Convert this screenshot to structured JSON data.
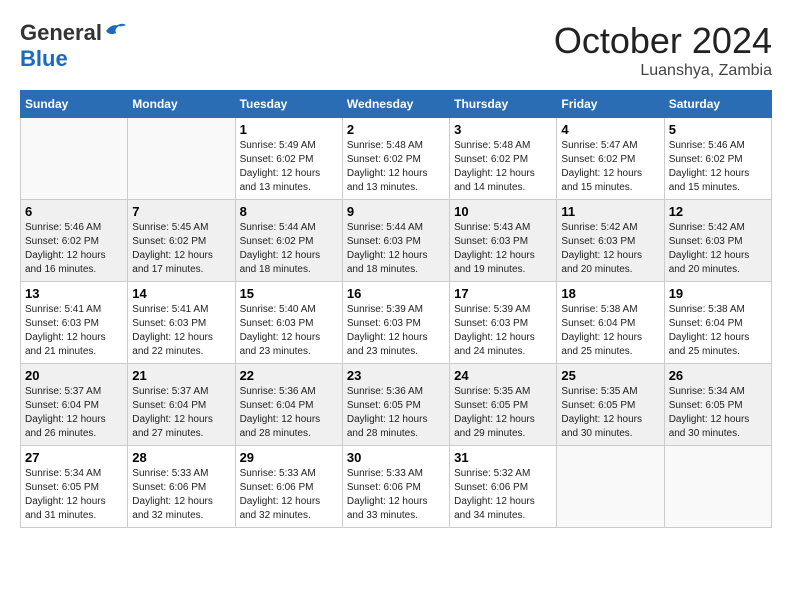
{
  "logo": {
    "general": "General",
    "blue": "Blue"
  },
  "title": {
    "month": "October 2024",
    "location": "Luanshya, Zambia"
  },
  "weekdays": [
    "Sunday",
    "Monday",
    "Tuesday",
    "Wednesday",
    "Thursday",
    "Friday",
    "Saturday"
  ],
  "weeks": [
    [
      {
        "day": "",
        "sunrise": "",
        "sunset": "",
        "daylight": "",
        "empty": true
      },
      {
        "day": "",
        "sunrise": "",
        "sunset": "",
        "daylight": "",
        "empty": true
      },
      {
        "day": "1",
        "sunrise": "Sunrise: 5:49 AM",
        "sunset": "Sunset: 6:02 PM",
        "daylight": "Daylight: 12 hours and 13 minutes."
      },
      {
        "day": "2",
        "sunrise": "Sunrise: 5:48 AM",
        "sunset": "Sunset: 6:02 PM",
        "daylight": "Daylight: 12 hours and 13 minutes."
      },
      {
        "day": "3",
        "sunrise": "Sunrise: 5:48 AM",
        "sunset": "Sunset: 6:02 PM",
        "daylight": "Daylight: 12 hours and 14 minutes."
      },
      {
        "day": "4",
        "sunrise": "Sunrise: 5:47 AM",
        "sunset": "Sunset: 6:02 PM",
        "daylight": "Daylight: 12 hours and 15 minutes."
      },
      {
        "day": "5",
        "sunrise": "Sunrise: 5:46 AM",
        "sunset": "Sunset: 6:02 PM",
        "daylight": "Daylight: 12 hours and 15 minutes."
      }
    ],
    [
      {
        "day": "6",
        "sunrise": "Sunrise: 5:46 AM",
        "sunset": "Sunset: 6:02 PM",
        "daylight": "Daylight: 12 hours and 16 minutes."
      },
      {
        "day": "7",
        "sunrise": "Sunrise: 5:45 AM",
        "sunset": "Sunset: 6:02 PM",
        "daylight": "Daylight: 12 hours and 17 minutes."
      },
      {
        "day": "8",
        "sunrise": "Sunrise: 5:44 AM",
        "sunset": "Sunset: 6:02 PM",
        "daylight": "Daylight: 12 hours and 18 minutes."
      },
      {
        "day": "9",
        "sunrise": "Sunrise: 5:44 AM",
        "sunset": "Sunset: 6:03 PM",
        "daylight": "Daylight: 12 hours and 18 minutes."
      },
      {
        "day": "10",
        "sunrise": "Sunrise: 5:43 AM",
        "sunset": "Sunset: 6:03 PM",
        "daylight": "Daylight: 12 hours and 19 minutes."
      },
      {
        "day": "11",
        "sunrise": "Sunrise: 5:42 AM",
        "sunset": "Sunset: 6:03 PM",
        "daylight": "Daylight: 12 hours and 20 minutes."
      },
      {
        "day": "12",
        "sunrise": "Sunrise: 5:42 AM",
        "sunset": "Sunset: 6:03 PM",
        "daylight": "Daylight: 12 hours and 20 minutes."
      }
    ],
    [
      {
        "day": "13",
        "sunrise": "Sunrise: 5:41 AM",
        "sunset": "Sunset: 6:03 PM",
        "daylight": "Daylight: 12 hours and 21 minutes."
      },
      {
        "day": "14",
        "sunrise": "Sunrise: 5:41 AM",
        "sunset": "Sunset: 6:03 PM",
        "daylight": "Daylight: 12 hours and 22 minutes."
      },
      {
        "day": "15",
        "sunrise": "Sunrise: 5:40 AM",
        "sunset": "Sunset: 6:03 PM",
        "daylight": "Daylight: 12 hours and 23 minutes."
      },
      {
        "day": "16",
        "sunrise": "Sunrise: 5:39 AM",
        "sunset": "Sunset: 6:03 PM",
        "daylight": "Daylight: 12 hours and 23 minutes."
      },
      {
        "day": "17",
        "sunrise": "Sunrise: 5:39 AM",
        "sunset": "Sunset: 6:03 PM",
        "daylight": "Daylight: 12 hours and 24 minutes."
      },
      {
        "day": "18",
        "sunrise": "Sunrise: 5:38 AM",
        "sunset": "Sunset: 6:04 PM",
        "daylight": "Daylight: 12 hours and 25 minutes."
      },
      {
        "day": "19",
        "sunrise": "Sunrise: 5:38 AM",
        "sunset": "Sunset: 6:04 PM",
        "daylight": "Daylight: 12 hours and 25 minutes."
      }
    ],
    [
      {
        "day": "20",
        "sunrise": "Sunrise: 5:37 AM",
        "sunset": "Sunset: 6:04 PM",
        "daylight": "Daylight: 12 hours and 26 minutes."
      },
      {
        "day": "21",
        "sunrise": "Sunrise: 5:37 AM",
        "sunset": "Sunset: 6:04 PM",
        "daylight": "Daylight: 12 hours and 27 minutes."
      },
      {
        "day": "22",
        "sunrise": "Sunrise: 5:36 AM",
        "sunset": "Sunset: 6:04 PM",
        "daylight": "Daylight: 12 hours and 28 minutes."
      },
      {
        "day": "23",
        "sunrise": "Sunrise: 5:36 AM",
        "sunset": "Sunset: 6:05 PM",
        "daylight": "Daylight: 12 hours and 28 minutes."
      },
      {
        "day": "24",
        "sunrise": "Sunrise: 5:35 AM",
        "sunset": "Sunset: 6:05 PM",
        "daylight": "Daylight: 12 hours and 29 minutes."
      },
      {
        "day": "25",
        "sunrise": "Sunrise: 5:35 AM",
        "sunset": "Sunset: 6:05 PM",
        "daylight": "Daylight: 12 hours and 30 minutes."
      },
      {
        "day": "26",
        "sunrise": "Sunrise: 5:34 AM",
        "sunset": "Sunset: 6:05 PM",
        "daylight": "Daylight: 12 hours and 30 minutes."
      }
    ],
    [
      {
        "day": "27",
        "sunrise": "Sunrise: 5:34 AM",
        "sunset": "Sunset: 6:05 PM",
        "daylight": "Daylight: 12 hours and 31 minutes."
      },
      {
        "day": "28",
        "sunrise": "Sunrise: 5:33 AM",
        "sunset": "Sunset: 6:06 PM",
        "daylight": "Daylight: 12 hours and 32 minutes."
      },
      {
        "day": "29",
        "sunrise": "Sunrise: 5:33 AM",
        "sunset": "Sunset: 6:06 PM",
        "daylight": "Daylight: 12 hours and 32 minutes."
      },
      {
        "day": "30",
        "sunrise": "Sunrise: 5:33 AM",
        "sunset": "Sunset: 6:06 PM",
        "daylight": "Daylight: 12 hours and 33 minutes."
      },
      {
        "day": "31",
        "sunrise": "Sunrise: 5:32 AM",
        "sunset": "Sunset: 6:06 PM",
        "daylight": "Daylight: 12 hours and 34 minutes."
      },
      {
        "day": "",
        "sunrise": "",
        "sunset": "",
        "daylight": "",
        "empty": true
      },
      {
        "day": "",
        "sunrise": "",
        "sunset": "",
        "daylight": "",
        "empty": true
      }
    ]
  ]
}
